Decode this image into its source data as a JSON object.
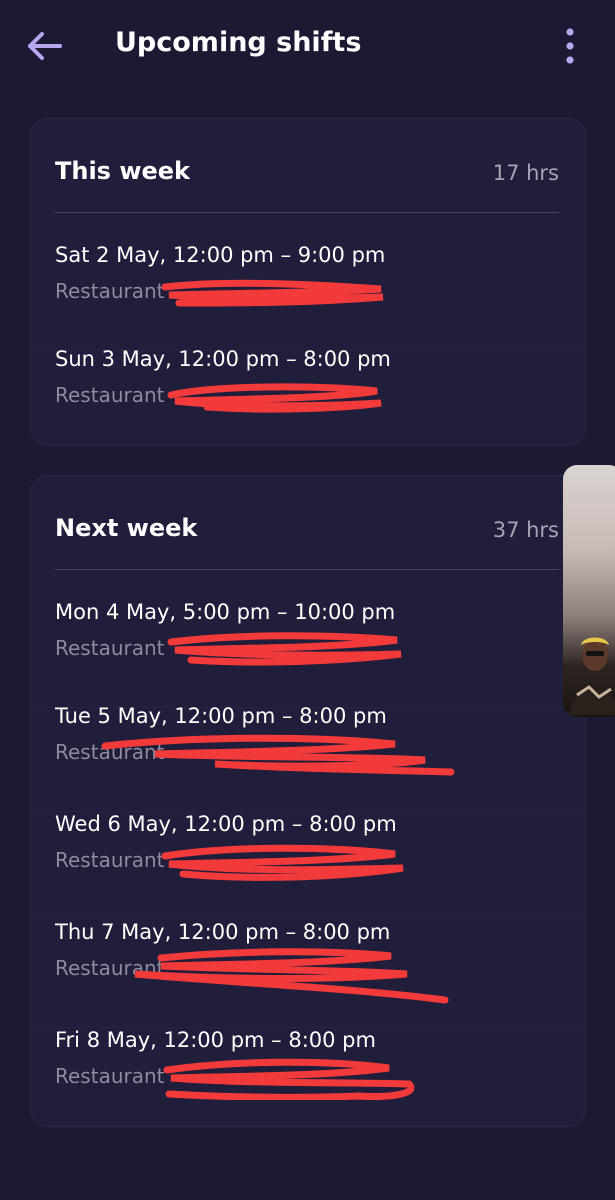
{
  "header": {
    "title": "Upcoming shifts",
    "back_icon": "arrow-left-icon",
    "menu_icon": "more-vert-icon",
    "accent_color": "#b9a6f0"
  },
  "weeks": [
    {
      "title": "This week",
      "hours": "17 hrs",
      "shifts": [
        {
          "time": "Sat 2 May, 12:00 pm – 9:00 pm",
          "location": "Restaurant"
        },
        {
          "time": "Sun 3 May, 12:00 pm – 8:00 pm",
          "location": "Restaurant"
        }
      ]
    },
    {
      "title": "Next week",
      "hours": "37 hrs",
      "shifts": [
        {
          "time": "Mon 4 May, 5:00 pm – 10:00 pm",
          "location": "Restaurant"
        },
        {
          "time": "Tue 5 May, 12:00 pm – 8:00 pm",
          "location": "Restaurant"
        },
        {
          "time": "Wed 6 May, 12:00 pm – 8:00 pm",
          "location": "Restaurant"
        },
        {
          "time": "Thu 7 May, 12:00 pm – 8:00 pm",
          "location": "Restaurant"
        },
        {
          "time": "Fri 8 May, 12:00 pm – 8:00 pm",
          "location": "Restaurant"
        }
      ]
    }
  ],
  "colors": {
    "background": "#1c1a33",
    "card": "#201e3a",
    "redaction": "#f23a3a",
    "secondary_text": "#8d8b9c"
  }
}
